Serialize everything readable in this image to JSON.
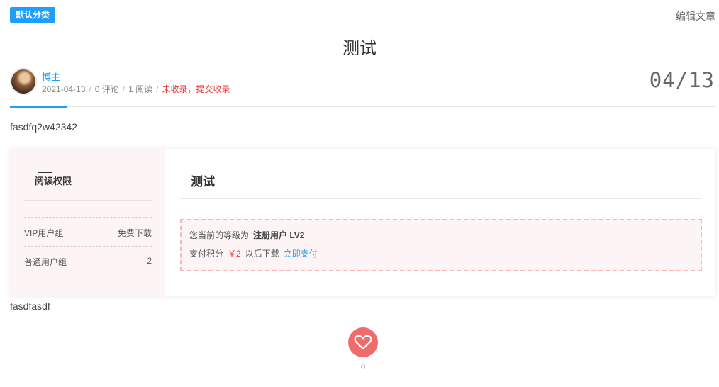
{
  "header": {
    "category": "默认分类",
    "edit": "编辑文章",
    "title": "测试"
  },
  "meta": {
    "author": "博主",
    "date": "2021-04-13",
    "comments": "0 评论",
    "reads": "1 阅读",
    "index_status": "未收录，提交收录",
    "date_big": "04/13"
  },
  "content": {
    "para1": "fasdfq2w42342",
    "para2": "fasdfasdf"
  },
  "permission": {
    "title": "阅读权限",
    "rows": [
      {
        "group": "VIP用户组",
        "value": "免费下载"
      },
      {
        "group": "普通用户组",
        "value": "2"
      }
    ]
  },
  "pay": {
    "title": "测试",
    "level_label": "您当前的等级为",
    "level_value": "注册用户 LV2",
    "points_label": "支付积分",
    "price": "￥2",
    "after": "以后下载",
    "pay_link": "立即支付"
  },
  "like": {
    "count": "0",
    "color": "#f06b6b"
  },
  "colors": {
    "accent": "#1e9fff",
    "danger": "#e4393c"
  }
}
